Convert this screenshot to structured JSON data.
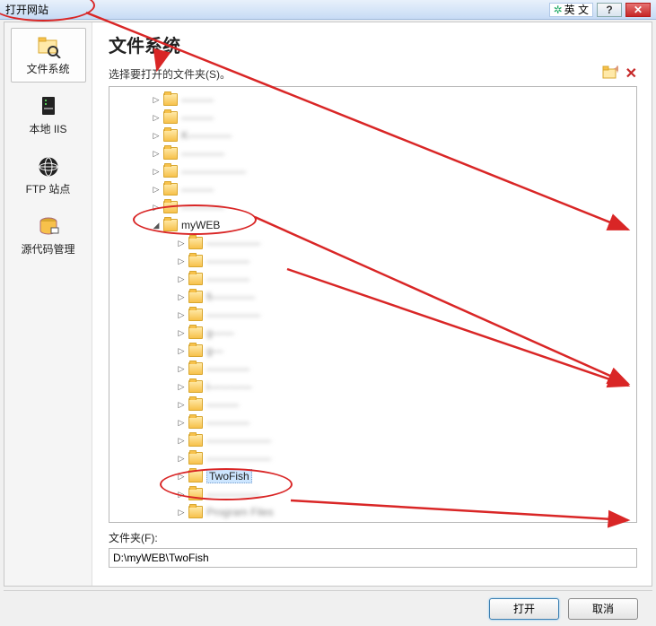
{
  "titlebar": {
    "title": "打开网站",
    "lang": "英 文"
  },
  "sidebar": {
    "items": [
      {
        "label": "文件系统"
      },
      {
        "label": "本地 IIS"
      },
      {
        "label": "FTP 站点"
      },
      {
        "label": "源代码管理"
      }
    ]
  },
  "main": {
    "heading": "文件系统",
    "prompt": "选择要打开的文件夹(S)。"
  },
  "tree": {
    "level1": [
      {
        "label": "———"
      },
      {
        "label": "———"
      },
      {
        "label": "K————"
      },
      {
        "label": "————"
      },
      {
        "label": "——————"
      },
      {
        "label": "———"
      },
      {
        "label": "————"
      }
    ],
    "myweb": {
      "label": "myWEB",
      "expanded": true
    },
    "level2": [
      {
        "label": "—————"
      },
      {
        "label": "————"
      },
      {
        "label": "————"
      },
      {
        "label": "fi————"
      },
      {
        "label": "—————"
      },
      {
        "label": "g——"
      },
      {
        "label": "g—"
      },
      {
        "label": "————"
      },
      {
        "label": "i————"
      },
      {
        "label": "———"
      },
      {
        "label": "————"
      },
      {
        "label": "——————"
      },
      {
        "label": "——————"
      }
    ],
    "twofish": {
      "label": "TwoFish",
      "selected": true
    },
    "after": [
      {
        "label": "—————"
      },
      {
        "label": "Program Files"
      }
    ]
  },
  "folderField": {
    "label": "文件夹(F):",
    "value": "D:\\myWEB\\TwoFish"
  },
  "footer": {
    "open": "打开",
    "cancel": "取消"
  }
}
